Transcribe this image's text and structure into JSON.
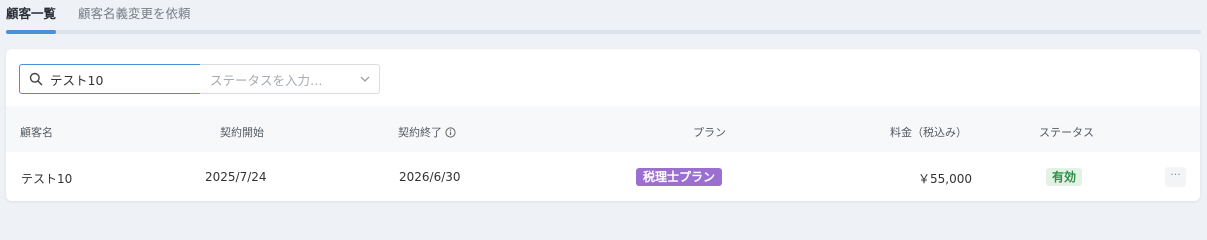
{
  "tabs": [
    {
      "label": "顧客一覧",
      "active": true
    },
    {
      "label": "顧客名義変更を依頼",
      "active": false
    }
  ],
  "search": {
    "value": "テスト10",
    "icon": "search-icon"
  },
  "status_filter": {
    "placeholder": "ステータスを入力…",
    "icon": "chevron-down-icon"
  },
  "table": {
    "columns": [
      {
        "label": "顧客名"
      },
      {
        "label": "契約開始"
      },
      {
        "label": "契約終了",
        "icon": "info-icon"
      },
      {
        "label": "プラン"
      },
      {
        "label": "料金（税込み）"
      },
      {
        "label": "ステータス"
      }
    ],
    "rows": [
      {
        "customer_name": "テスト10",
        "contract_start": "2025/7/24",
        "contract_end": "2026/6/30",
        "plan": "税理士プラン",
        "fee": "￥55,000",
        "status": "有効",
        "more": "···"
      }
    ]
  },
  "colors": {
    "accent": "#4a90d9",
    "plan_badge": "#9b6fd0",
    "status_badge_bg": "#e2f3e6",
    "status_badge_text": "#2f8f4a"
  }
}
